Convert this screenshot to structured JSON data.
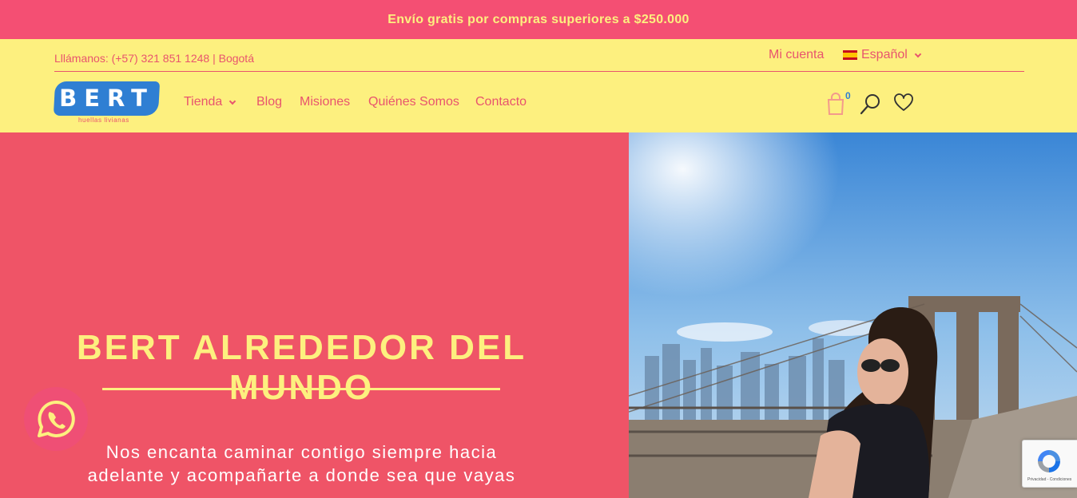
{
  "announcement": "Envío gratis por compras superiores a $250.000",
  "header": {
    "phone": "Lllámanos: (+57) 321 851 1248 | Bogotá",
    "account": "Mi cuenta",
    "language": "Español",
    "cart_count": "0"
  },
  "logo": {
    "text": "BERT",
    "tagline": "huellas livianas"
  },
  "nav": {
    "items": [
      {
        "label": "Tienda"
      },
      {
        "label": "Blog"
      },
      {
        "label": "Misiones"
      },
      {
        "label": "Quiénes Somos"
      },
      {
        "label": "Contacto"
      }
    ]
  },
  "hero": {
    "title": "BERT ALREDEDOR DEL MUNDO",
    "subtitle_line1": "Nos encanta caminar contigo siempre hacia",
    "subtitle_line2": "adelante y acompañarte a donde sea que vayas"
  },
  "recaptcha": {
    "label": "Privacidad - Condiciones"
  },
  "colors": {
    "pink": "#f44f73",
    "hero_pink": "#ef5467",
    "yellow": "#fdf07f",
    "text_pink": "#e8546e",
    "blue": "#2f7fd3"
  },
  "icons": [
    "spain-flag-icon",
    "chevron-down-icon",
    "shopping-bag-icon",
    "search-icon",
    "heart-icon",
    "whatsapp-icon",
    "recaptcha-icon"
  ]
}
